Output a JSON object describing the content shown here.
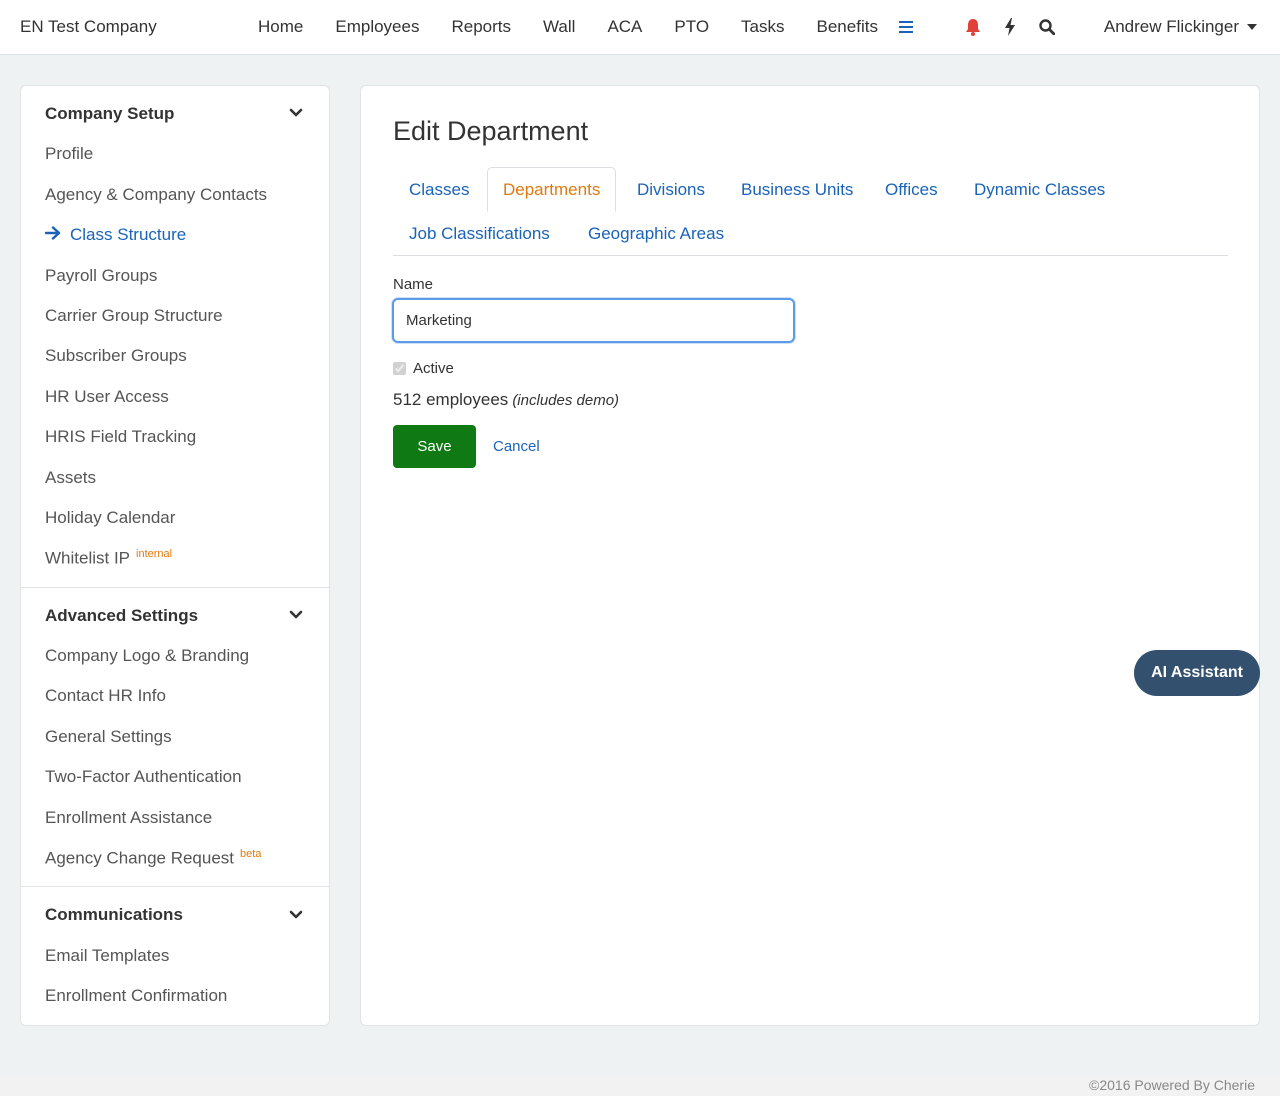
{
  "header": {
    "brand": "EN Test Company",
    "nav": [
      "Home",
      "Employees",
      "Reports",
      "Wall",
      "ACA",
      "PTO",
      "Tasks",
      "Benefits"
    ],
    "user_name": "Andrew Flickinger",
    "icons": [
      "hamburger-menu-icon",
      "bell-icon",
      "lightning-icon",
      "search-icon"
    ],
    "colors": {
      "bell": "#e0423a",
      "menu": "#1a63b8"
    }
  },
  "sidebar": {
    "company_setup": {
      "title": "Company Setup",
      "items": [
        {
          "label": "Profile"
        },
        {
          "label": "Agency & Company Contacts"
        },
        {
          "label": "Class Structure",
          "active": true
        },
        {
          "label": "Payroll Groups"
        },
        {
          "label": "Carrier Group Structure"
        },
        {
          "label": "Subscriber Groups"
        },
        {
          "label": "HR User Access"
        },
        {
          "label": "HRIS Field Tracking"
        },
        {
          "label": "Assets"
        },
        {
          "label": "Holiday Calendar"
        },
        {
          "label": "Whitelist IP",
          "badge": "internal"
        }
      ]
    },
    "advanced_settings": {
      "title": "Advanced Settings",
      "items": [
        {
          "label": "Company Logo & Branding"
        },
        {
          "label": "Contact HR Info"
        },
        {
          "label": "General Settings"
        },
        {
          "label": "Two-Factor Authentication"
        },
        {
          "label": "Enrollment Assistance"
        },
        {
          "label": "Agency Change Request",
          "badge": "beta"
        }
      ]
    },
    "communications": {
      "title": "Communications",
      "items": [
        {
          "label": "Email Templates"
        },
        {
          "label": "Enrollment Confirmation"
        }
      ]
    }
  },
  "main": {
    "title": "Edit Department",
    "tabs": [
      "Classes",
      "Departments",
      "Divisions",
      "Business Units",
      "Offices",
      "Dynamic Classes",
      "Job Classifications",
      "Geographic Areas"
    ],
    "active_tab": "Departments",
    "form": {
      "name_label": "Name",
      "name_value": "Marketing",
      "active_label": "Active",
      "active_checked": true,
      "employee_count": "512 employees",
      "count_note": "(includes demo)",
      "save_label": "Save",
      "cancel_label": "Cancel"
    }
  },
  "ai_assistant_label": "AI Assistant",
  "footer": "©2016 Powered By Cherie"
}
